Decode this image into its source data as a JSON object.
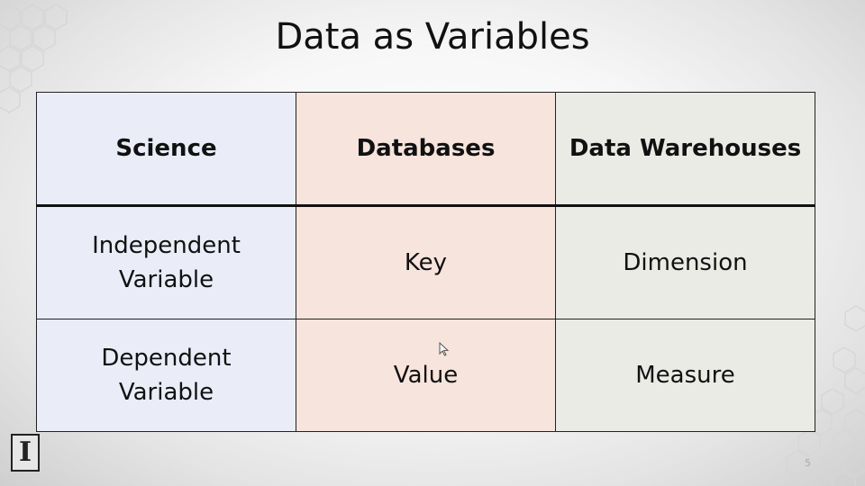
{
  "slide": {
    "title": "Data as Variables",
    "page_number": "5"
  },
  "table": {
    "headers": [
      "Science",
      "Databases",
      "Data Warehouses"
    ],
    "rows": [
      [
        "Independent\nVariable",
        "Key",
        "Dimension"
      ],
      [
        "Dependent\nVariable",
        "Value",
        "Measure"
      ]
    ]
  },
  "logo": {
    "icon": "illinois-block-i-icon"
  },
  "colors": {
    "science_column": "#eaedf8",
    "databases_column": "#f7e4dc",
    "warehouses_column": "#ebebe6"
  }
}
